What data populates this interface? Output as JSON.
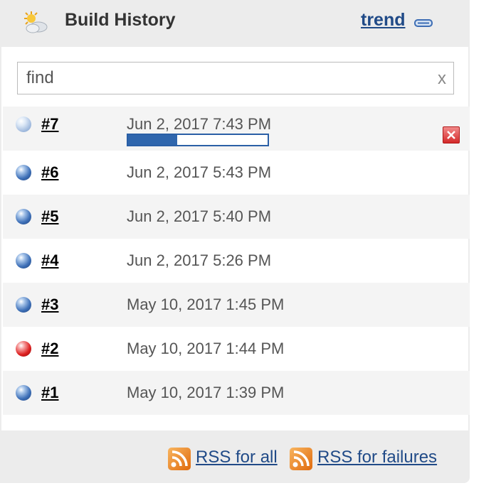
{
  "header": {
    "title": "Build History",
    "trend_label": "trend",
    "weather_icon": "sun-cloud-icon",
    "collapse_icon": "collapse-icon"
  },
  "search": {
    "placeholder": "find",
    "value": "find",
    "clear_label": "x"
  },
  "builds": [
    {
      "number": "#7",
      "date": "Jun 2, 2017 7:43 PM",
      "status": "in-progress",
      "progress_fraction": 0.35
    },
    {
      "number": "#6",
      "date": "Jun 2, 2017 5:43 PM",
      "status": "success"
    },
    {
      "number": "#5",
      "date": "Jun 2, 2017 5:40 PM",
      "status": "success"
    },
    {
      "number": "#4",
      "date": "Jun 2, 2017 5:26 PM",
      "status": "success"
    },
    {
      "number": "#3",
      "date": "May 10, 2017 1:45 PM",
      "status": "success"
    },
    {
      "number": "#2",
      "date": "May 10, 2017 1:44 PM",
      "status": "failure"
    },
    {
      "number": "#1",
      "date": "May 10, 2017 1:39 PM",
      "status": "success"
    }
  ],
  "footer": {
    "rss_all_label": "RSS for all",
    "rss_failures_label": "RSS for failures"
  },
  "colors": {
    "link": "#204a87",
    "success": "#3e70b8",
    "failure": "#dd2020",
    "progress": "#2f66ad"
  }
}
